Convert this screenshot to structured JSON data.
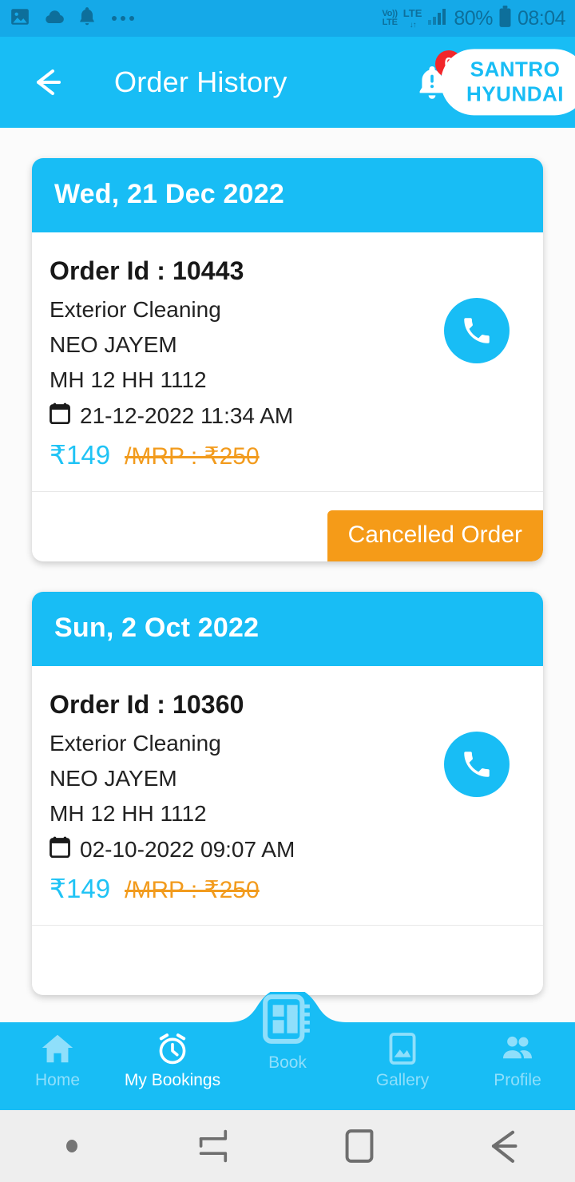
{
  "status_bar": {
    "left_icons": [
      "image-icon",
      "cloud-icon",
      "bell-icon",
      "more-dots-icon"
    ],
    "volte_top": "Vo))",
    "volte_bottom": "LTE",
    "network_type": "LTE",
    "network_arrows": "↓↑",
    "battery_percent": "80%",
    "clock": "08:04"
  },
  "app_bar": {
    "back_icon": "back-arrow-icon",
    "title": "Order History",
    "notification_icon": "bell-alert-icon",
    "notification_count": "0",
    "brand_line1": "SANTRO",
    "brand_line2": "HYUNDAI"
  },
  "orders": [
    {
      "date_header": "Wed, 21 Dec 2022",
      "order_id_label": "Order Id : 10443",
      "service": "Exterior Cleaning",
      "vehicle_model": "NEO JAYEM",
      "vehicle_number": "MH 12 HH 1112",
      "datetime": "21-12-2022 11:34 AM",
      "price": "₹149",
      "mrp": "/MRP : ₹250",
      "status": "Cancelled Order",
      "call_icon": "phone-icon",
      "calendar_icon": "calendar-icon"
    },
    {
      "date_header": "Sun, 2 Oct 2022",
      "order_id_label": "Order Id : 10360",
      "service": "Exterior Cleaning",
      "vehicle_model": "NEO JAYEM",
      "vehicle_number": "MH 12 HH 1112",
      "datetime": "02-10-2022 09:07 AM",
      "price": "₹149",
      "mrp": "/MRP : ₹250",
      "status": "",
      "call_icon": "phone-icon",
      "calendar_icon": "calendar-icon"
    }
  ],
  "bottom_nav": {
    "items": [
      {
        "label": "Home",
        "icon": "home-icon",
        "active": false
      },
      {
        "label": "My Bookings",
        "icon": "alarm-clock-icon",
        "active": true
      },
      {
        "label": "Book",
        "icon": "notebook-icon",
        "active": false
      },
      {
        "label": "Gallery",
        "icon": "image-frame-icon",
        "active": false
      },
      {
        "label": "Profile",
        "icon": "people-icon",
        "active": false
      }
    ]
  },
  "system_nav": {
    "items": [
      "dot-indicator",
      "recents-icon",
      "home-square-icon",
      "back-icon"
    ]
  },
  "colors": {
    "primary": "#18bdf5",
    "status_bar": "#15a9e8",
    "accent_orange": "#f59b18",
    "mrp_orange": "#f29b1d",
    "price_cyan": "#1fc3f5",
    "badge_red": "#f2262a",
    "page_bg": "#fbfbfb"
  }
}
